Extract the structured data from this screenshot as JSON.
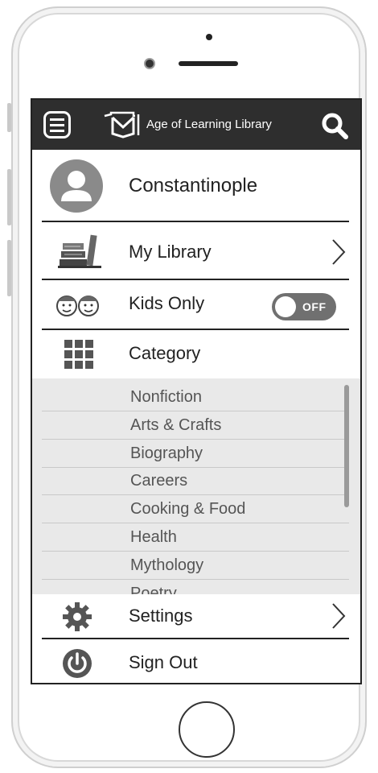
{
  "header": {
    "title": "Age of Learning Library",
    "menu_icon": "hamburger-menu-icon",
    "logo_icon": "open-book-logo-icon",
    "search_icon": "search-icon"
  },
  "profile": {
    "name": "Constantinople",
    "avatar_icon": "user-avatar-icon"
  },
  "menu": {
    "my_library": {
      "label": "My Library",
      "icon": "books-icon"
    },
    "kids_only": {
      "label": "Kids Only",
      "icon": "kids-faces-icon",
      "toggle_state": "OFF"
    },
    "category": {
      "label": "Category",
      "icon": "grid-icon"
    },
    "settings": {
      "label": "Settings",
      "icon": "gear-icon"
    },
    "sign_out": {
      "label": "Sign Out",
      "icon": "power-icon"
    }
  },
  "categories": [
    "Nonfiction",
    "Arts & Crafts",
    "Biography",
    "Careers",
    "Cooking & Food",
    "Health",
    "Mythology",
    "Poetry"
  ],
  "colors": {
    "header_bg": "#2e2e2e",
    "list_bg": "#e9e9e9",
    "toggle_bg": "#707070"
  }
}
